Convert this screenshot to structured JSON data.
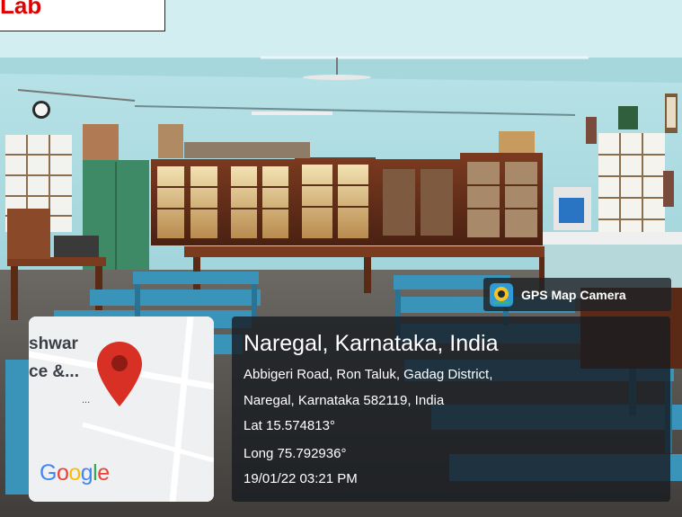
{
  "label": {
    "text": "Lab"
  },
  "badge": {
    "text": "GPS Map Camera"
  },
  "map": {
    "line1": "shwar",
    "line2": "ce &...",
    "dots": "...",
    "logo_letters": [
      "G",
      "o",
      "o",
      "g",
      "l",
      "e"
    ],
    "logo_colors": [
      "#4285F4",
      "#EA4335",
      "#FBBC05",
      "#4285F4",
      "#34A853",
      "#EA4335"
    ],
    "pin_color": "#d93025"
  },
  "location": {
    "title": "Naregal, Karnataka, India",
    "address_line1": "Abbigeri Road, Ron Taluk, Gadag District,",
    "address_line2": "Naregal, Karnataka 582119, India",
    "lat": "Lat 15.574813°",
    "long": "Long 75.792936°",
    "timestamp": "19/01/22 03:21 PM"
  }
}
